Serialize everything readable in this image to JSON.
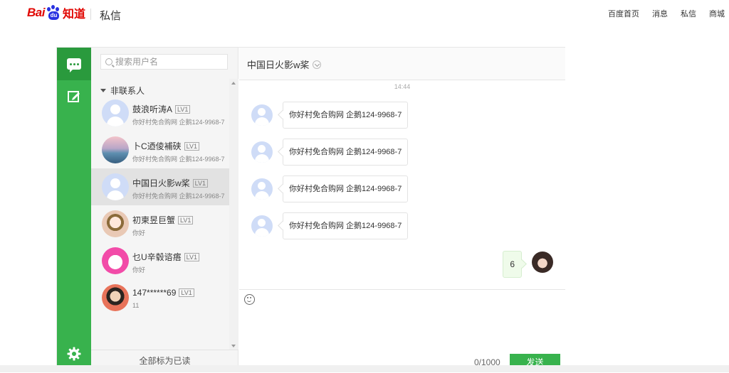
{
  "header": {
    "logo_left": "Bai",
    "logo_paw": "du",
    "logo_right": "知道",
    "page_title": "私信",
    "nav": [
      "百度首页",
      "消息",
      "私信",
      "商城"
    ]
  },
  "sidebar_rail": {
    "icons": [
      "chat-bubble-icon",
      "compose-icon",
      "gear-icon"
    ],
    "accent": "#38b24d"
  },
  "contacts": {
    "search_placeholder": "搜索用户名",
    "group_label": "非联系人",
    "items": [
      {
        "name": "鼓浪听涛A",
        "level": "LV1",
        "preview": "你好村免合购网 企鹅124-9968-7"
      },
      {
        "name": "卜C迺倰補硖",
        "level": "LV1",
        "preview": "你好村免合购网 企鹅124-9968-7"
      },
      {
        "name": "中国日火影w桨",
        "level": "LV1",
        "preview": "你好村免合购网 企鹅124-9968-7"
      },
      {
        "name": "初柬昱巨蟹",
        "level": "LV1",
        "preview": "你好"
      },
      {
        "name": "乜U辛毂谘痦",
        "level": "LV1",
        "preview": "你好"
      },
      {
        "name": "147******69",
        "level": "LV1",
        "preview": "11"
      }
    ],
    "mark_all_read": "全部标为已读"
  },
  "chat": {
    "title": "中国日火影w桨",
    "timestamp": "14:44",
    "messages": [
      "你好村免合购网 企鹅124-9968-7",
      "你好村免合购网 企鹅124-9968-7",
      "你好村免合购网 企鹅124-9968-7",
      "你好村免合购网 企鹅124-9968-7"
    ],
    "my_message": "6",
    "counter": "0/1000",
    "send_label": "发送"
  }
}
